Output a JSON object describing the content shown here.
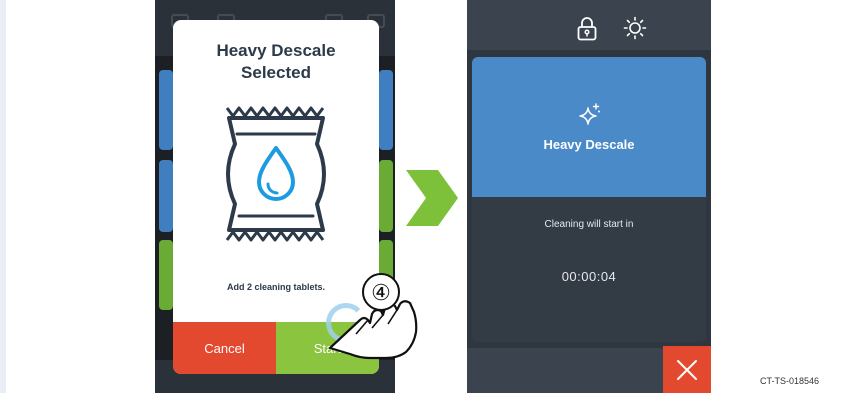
{
  "modal": {
    "title_line1": "Heavy Descale",
    "title_line2": "Selected",
    "message": "Add 2 cleaning tablets.",
    "cancel_label": "Cancel",
    "start_label": "Start"
  },
  "step_marker": "④",
  "right_screen": {
    "card_title": "Heavy Descale",
    "countdown_message": "Cleaning will start in",
    "timer": "00:00:04",
    "icons": [
      "lock-icon",
      "brightness-icon",
      "sparkle-icon",
      "close-icon"
    ]
  },
  "colors": {
    "accent_blue": "#4a8ac9",
    "cancel_red": "#e3492f",
    "start_green": "#8bc53f",
    "arrow_green": "#7dc13a",
    "dark_panel": "#2e3640"
  },
  "document_code": "CT-TS-018546"
}
